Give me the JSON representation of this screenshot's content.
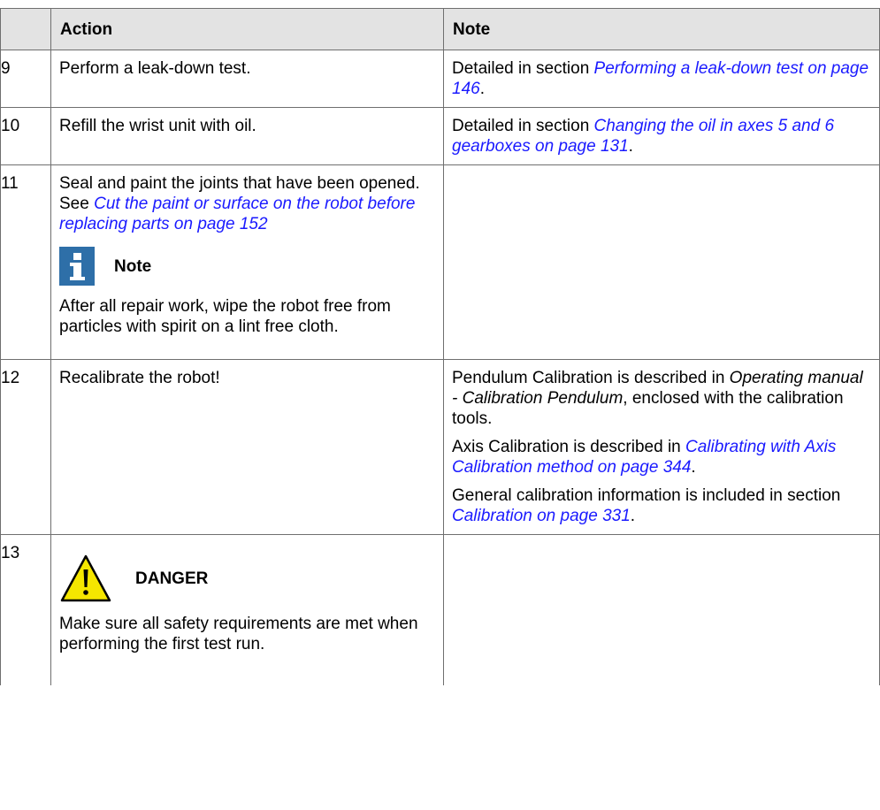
{
  "table": {
    "headers": {
      "number": "",
      "action": "Action",
      "note": "Note"
    },
    "rows": [
      {
        "number": "9",
        "action": "Perform a leak-down test.",
        "note": {
          "prefix": "Detailed in section ",
          "link": "Performing a leak-down test on page 146",
          "suffix": "."
        }
      },
      {
        "number": "10",
        "action": "Refill the wrist unit with oil.",
        "note": {
          "prefix": "Detailed in section ",
          "link": "Changing the oil in axes 5 and 6 gearboxes on page 131",
          "suffix": "."
        }
      },
      {
        "number": "11",
        "action": {
          "text": "Seal and paint the joints that have been opened. See ",
          "link": "Cut the paint or surface on the robot before replacing parts on page 152",
          "callout": {
            "icon": "info-note-icon",
            "label": "Note"
          },
          "callout_text": "After all repair work, wipe the robot free from particles with spirit on a lint free cloth."
        },
        "note": ""
      },
      {
        "number": "12",
        "action": "Recalibrate the robot!",
        "note": {
          "p1_prefix": "Pendulum Calibration is described in ",
          "p1_italic": "Operating manual - Calibration Pendulum",
          "p1_suffix": ", enclosed with the calibration tools.",
          "p2_prefix": "Axis Calibration is described in ",
          "p2_link": "Calibrating with Axis Calibration method on page 344",
          "p2_suffix": ".",
          "p3_prefix": "General calibration information is included in section ",
          "p3_link": "Calibration on page 331",
          "p3_suffix": "."
        }
      },
      {
        "number": "13",
        "action": {
          "callout": {
            "icon": "warning-triangle-icon",
            "label": "DANGER"
          },
          "callout_text": "Make sure all safety requirements are met when performing the first test run."
        },
        "note": ""
      }
    ]
  },
  "colors": {
    "link": "#1a1aff",
    "header_bg": "#e3e3e3",
    "note_icon": "#2e6fa8",
    "danger_icon": "#f5e600"
  }
}
